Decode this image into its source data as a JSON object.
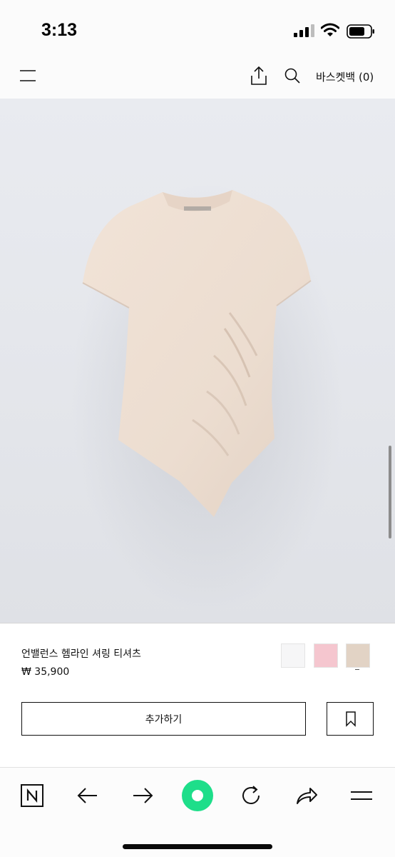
{
  "status_bar": {
    "time": "3:13"
  },
  "top_nav": {
    "menu_icon": "hamburger-menu-icon",
    "share_icon": "share-icon",
    "search_icon": "search-icon",
    "basket_label": "바스켓백 (0)"
  },
  "product": {
    "image": "beige-asymmetric-shirring-tshirt",
    "name": "언밸런스 헴라인 셔링 티셔츠",
    "price": "₩ 35,900",
    "colors": [
      {
        "name": "white",
        "hex": "#f6f6f7"
      },
      {
        "name": "pink",
        "hex": "#f5c6cf"
      },
      {
        "name": "beige",
        "hex": "#e2d3c5"
      }
    ],
    "selected_color": "beige",
    "add_button_label": "추가하기",
    "bookmark_icon": "bookmark-icon"
  },
  "browser_bar": {
    "icons": [
      "naver-n-icon",
      "back-arrow-icon",
      "forward-arrow-icon",
      "green-circle-icon",
      "reload-icon",
      "share-arrow-icon",
      "menu-icon"
    ],
    "accent_color": "#1ede8a"
  }
}
